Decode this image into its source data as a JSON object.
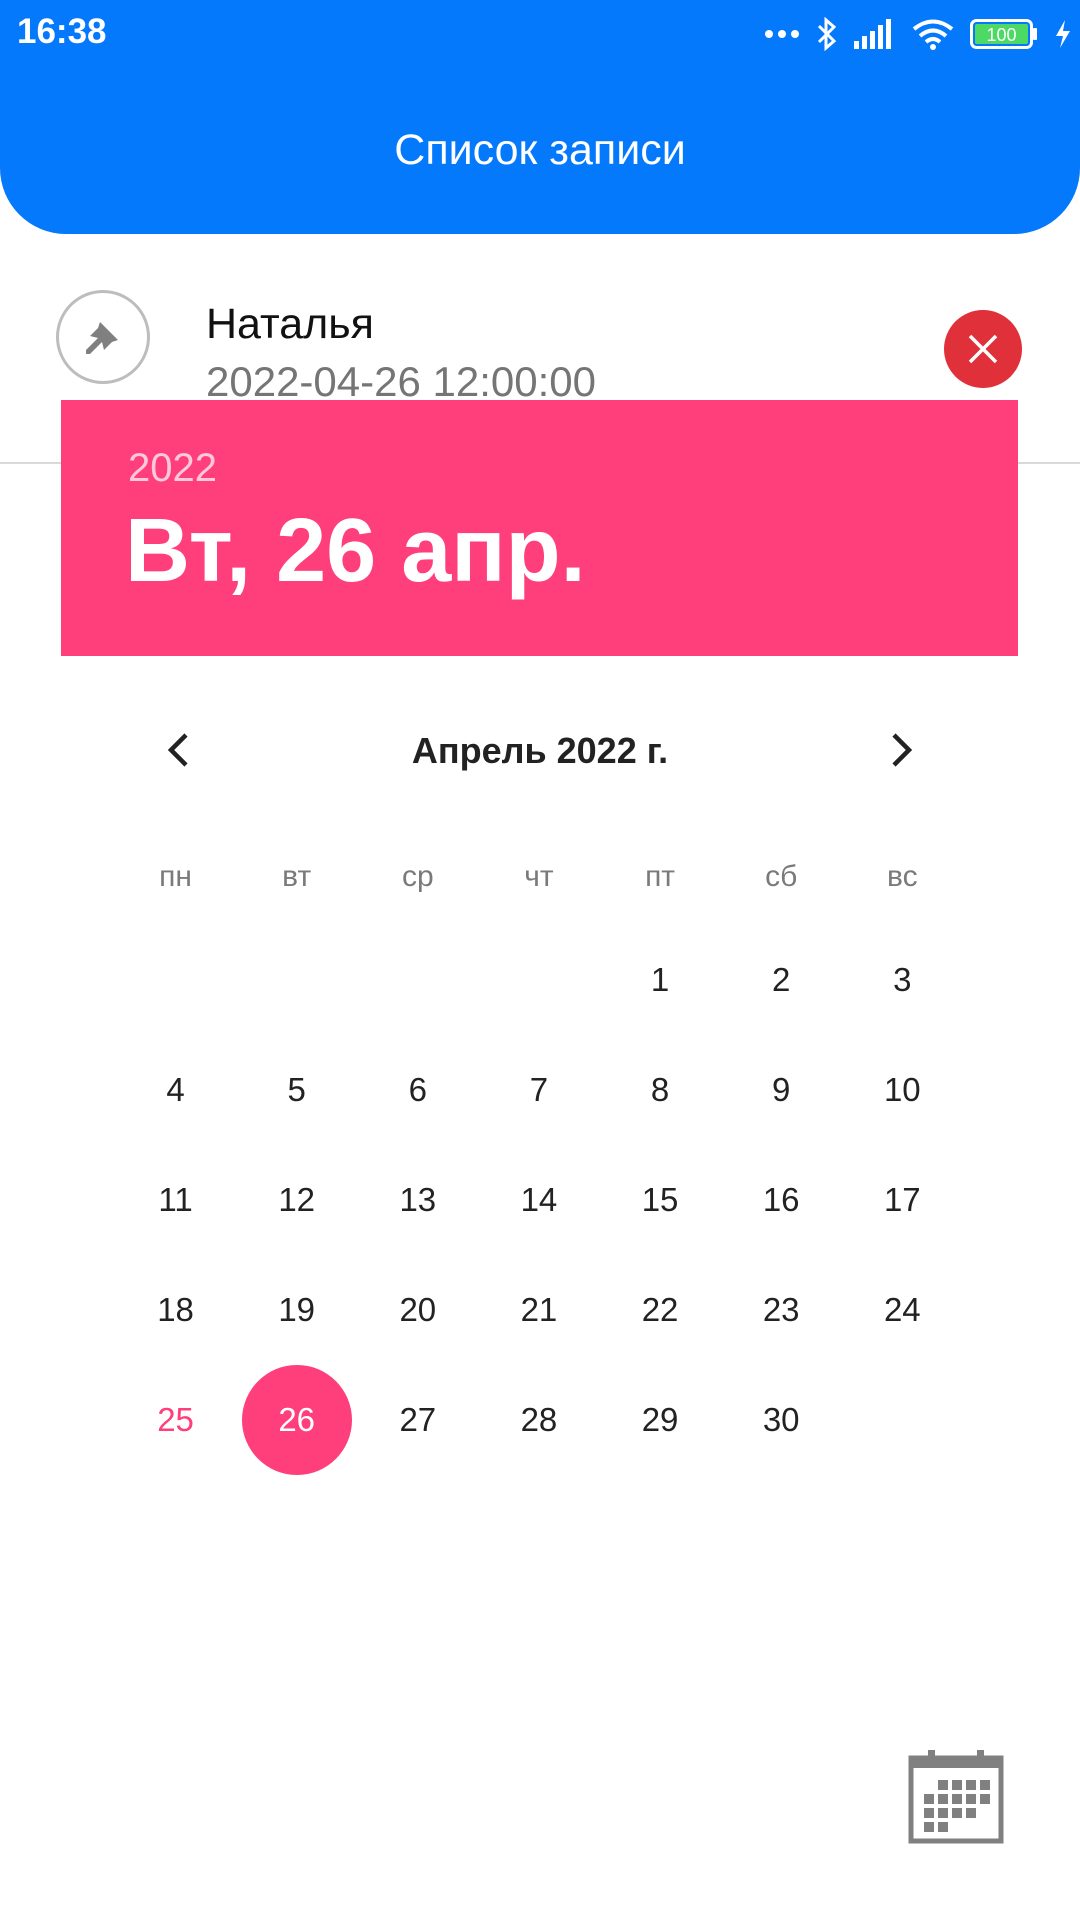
{
  "status_bar": {
    "time": "16:38",
    "battery": "100",
    "icons": [
      "more-icon",
      "bluetooth-icon",
      "signal-icon",
      "wifi-icon",
      "battery-icon",
      "charging-icon"
    ]
  },
  "header": {
    "title": "Список записи"
  },
  "list_item": {
    "name": "Наталья",
    "datetime": "2022-04-26 12:00:00",
    "icons": [
      "pin-icon",
      "close-icon"
    ]
  },
  "date_picker": {
    "year": "2022",
    "selected_date": "Вт, 26 апр.",
    "month_title": "Апрель 2022 г.",
    "weekdays": [
      "пн",
      "вт",
      "ср",
      "чт",
      "пт",
      "сб",
      "вс"
    ],
    "weeks": [
      [
        "",
        "",
        "",
        "",
        "1",
        "2",
        "3"
      ],
      [
        "4",
        "5",
        "6",
        "7",
        "8",
        "9",
        "10"
      ],
      [
        "11",
        "12",
        "13",
        "14",
        "15",
        "16",
        "17"
      ],
      [
        "18",
        "19",
        "20",
        "21",
        "22",
        "23",
        "24"
      ],
      [
        "25",
        "26",
        "27",
        "28",
        "29",
        "30",
        ""
      ]
    ],
    "today": "25",
    "selected": "26"
  },
  "colors": {
    "header_blue": "#0479fb",
    "accent_pink": "#fe3f7b",
    "delete_red": "#e0303a"
  },
  "fab": {
    "icon": "calendar-icon"
  }
}
